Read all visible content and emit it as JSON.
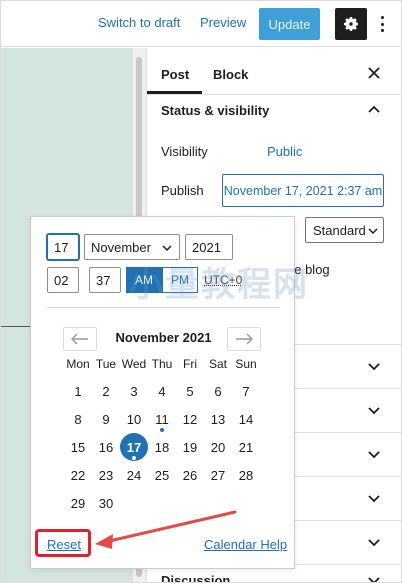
{
  "toolbar": {
    "switch_to_draft": "Switch to draft",
    "preview": "Preview",
    "update": "Update",
    "settings_icon": "gear-icon",
    "more_icon": "more-vertical-icon"
  },
  "sidebar": {
    "tabs": [
      {
        "label": "Post",
        "active": true
      },
      {
        "label": "Block",
        "active": false
      }
    ],
    "close_icon": "close-icon",
    "status_panel": {
      "title": "Status & visibility",
      "visibility_label": "Visibility",
      "visibility_value": "Public",
      "publish_label": "Publish",
      "publish_value": "November 17, 2021 2:37 am",
      "format_value": "Standard",
      "sticky_fragment": "he blog"
    },
    "bottom_panel_title": "Discussion"
  },
  "datepicker": {
    "day": "17",
    "month": "November",
    "year": "2021",
    "hour": "02",
    "minute": "37",
    "am": "AM",
    "pm": "PM",
    "timezone": "UTC+0",
    "caption": "November 2021",
    "weekdays": [
      "Mon",
      "Tue",
      "Wed",
      "Thu",
      "Fri",
      "Sat",
      "Sun"
    ],
    "days": [
      "1",
      "2",
      "3",
      "4",
      "5",
      "6",
      "7",
      "8",
      "9",
      "10",
      "11",
      "12",
      "13",
      "14",
      "15",
      "16",
      "17",
      "18",
      "19",
      "20",
      "21",
      "22",
      "23",
      "24",
      "25",
      "26",
      "27",
      "28",
      "29",
      "30"
    ],
    "selected_day": "17",
    "today_marker_day": "11",
    "reset": "Reset",
    "calendar_help": "Calendar Help"
  },
  "annotation": {
    "highlight_color": "#e2202a",
    "watermark": "小量教程网"
  },
  "colors": {
    "accent": "#2271b1",
    "canvas": "#d4e4de"
  }
}
